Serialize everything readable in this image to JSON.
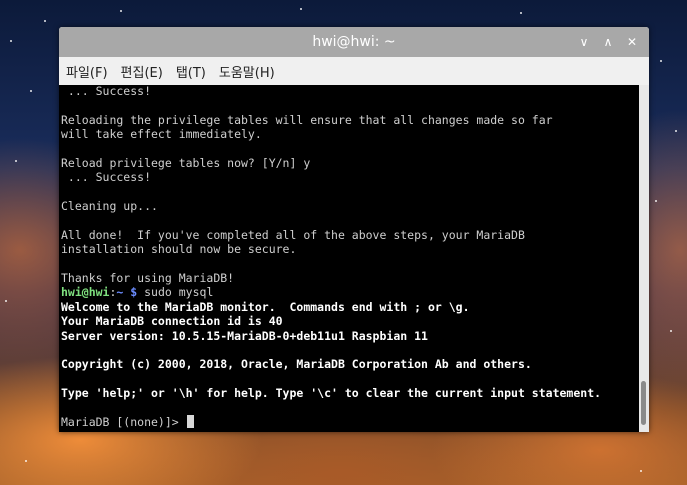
{
  "window": {
    "title": "hwi@hwi: ~"
  },
  "menu": [
    "파일(F)",
    "편집(E)",
    "탭(T)",
    "도움말(H)"
  ],
  "controls": {
    "minimize_icon": "∨",
    "maximize_icon": "∧",
    "close_icon": "✕"
  },
  "terminal": {
    "lines": [
      " ... Success!",
      "",
      "Reloading the privilege tables will ensure that all changes made so far",
      "will take effect immediately.",
      "",
      "Reload privilege tables now? [Y/n] y",
      " ... Success!",
      "",
      "Cleaning up...",
      "",
      "All done!  If you've completed all of the above steps, your MariaDB",
      "installation should now be secure.",
      "",
      "Thanks for using MariaDB!"
    ],
    "prompt": {
      "user": "hwi@hwi",
      "sep": ":",
      "path": "~",
      "dollar": " $",
      "command": " sudo mysql"
    },
    "output": [
      "Welcome to the MariaDB monitor.  Commands end with ; or \\g.",
      "Your MariaDB connection id is 40",
      "Server version: 10.5.15-MariaDB-0+deb11u1 Raspbian 11",
      "",
      "Copyright (c) 2000, 2018, Oracle, MariaDB Corporation Ab and others.",
      "",
      "Type 'help;' or '\\h' for help. Type '\\c' to clear the current input statement.",
      ""
    ],
    "mariadb_prompt": "MariaDB [(none)]> "
  }
}
